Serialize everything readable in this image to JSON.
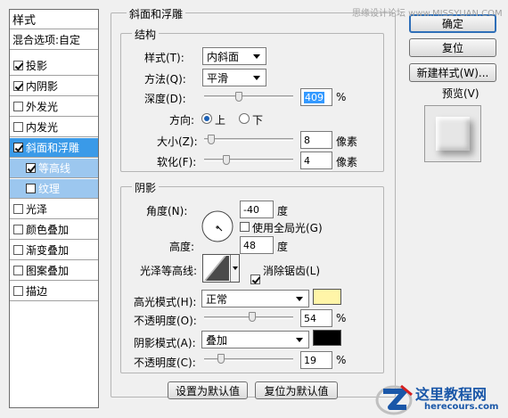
{
  "style_list": {
    "header": "样式",
    "blend_options": "混合选项:自定",
    "items": [
      {
        "label": "投影",
        "checked": true
      },
      {
        "label": "内阴影",
        "checked": true
      },
      {
        "label": "外发光",
        "checked": false
      },
      {
        "label": "内发光",
        "checked": false
      },
      {
        "label": "斜面和浮雕",
        "checked": true,
        "selected": true
      },
      {
        "label": "等高线",
        "checked": true,
        "sub": true
      },
      {
        "label": "纹理",
        "checked": false,
        "sub": true
      },
      {
        "label": "光泽",
        "checked": false
      },
      {
        "label": "颜色叠加",
        "checked": false
      },
      {
        "label": "渐变叠加",
        "checked": false
      },
      {
        "label": "图案叠加",
        "checked": false
      },
      {
        "label": "描边",
        "checked": false
      }
    ]
  },
  "bevel": {
    "section_title": "斜面和浮雕",
    "structure_title": "结构",
    "style_label": "样式(T):",
    "style_value": "内斜面",
    "technique_label": "方法(Q):",
    "technique_value": "平滑",
    "depth_label": "深度(D):",
    "depth_value": "409",
    "depth_unit": "%",
    "direction_label": "方向:",
    "direction_up": "上",
    "direction_down": "下",
    "size_label": "大小(Z):",
    "size_value": "8",
    "size_unit": "像素",
    "soften_label": "软化(F):",
    "soften_value": "4",
    "soften_unit": "像素"
  },
  "shading": {
    "title": "阴影",
    "angle_label": "角度(N):",
    "angle_value": "-40",
    "angle_unit": "度",
    "global_light_label": "使用全局光(G)",
    "global_light_checked": false,
    "altitude_label": "高度:",
    "altitude_value": "48",
    "altitude_unit": "度",
    "gloss_contour_label": "光泽等高线:",
    "anti_aliased_label": "消除锯齿(L)",
    "anti_aliased_checked": true,
    "highlight_mode_label": "高光模式(H):",
    "highlight_mode_value": "正常",
    "highlight_color": "#fff5a8",
    "highlight_opacity_label": "不透明度(O):",
    "highlight_opacity_value": "54",
    "highlight_opacity_unit": "%",
    "shadow_mode_label": "阴影模式(A):",
    "shadow_mode_value": "叠加",
    "shadow_color": "#000000",
    "shadow_opacity_label": "不透明度(C):",
    "shadow_opacity_value": "19",
    "shadow_opacity_unit": "%"
  },
  "bottom_buttons": {
    "make_default": "设置为默认值",
    "reset_default": "复位为默认值"
  },
  "right_panel": {
    "ok": "确定",
    "reset": "复位",
    "new_style": "新建样式(W)...",
    "preview_label": "预览(V)",
    "preview_checked": true
  },
  "watermarks": {
    "top": "思缘设计论坛 www.MISSYUAN.COM",
    "logo_text": "这里教程网",
    "logo_url": "herecours.com"
  }
}
